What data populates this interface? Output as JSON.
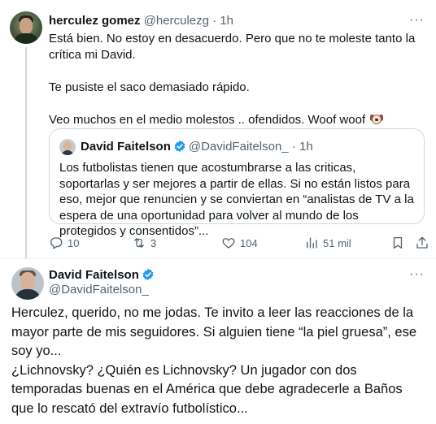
{
  "tweet1": {
    "author_name": "herculez gomez",
    "author_handle": "@herculezg",
    "separator": "·",
    "time": "1h",
    "more": "···",
    "lines": [
      "Está bien. No estoy en desacuerdo. Pero que no te moleste tanto la crítica mi David.",
      "Te pusiste el saco demasiado rápido.",
      "Veo muchos en el medio molestos .. ofendidos. Woof woof"
    ],
    "emoji_icon": "dog-face-icon",
    "quote": {
      "author_name": "David Faitelson",
      "author_handle": "@DavidFaitelson_",
      "separator": "·",
      "time": "1h",
      "text": "Los futbolistas tienen que acostumbrarse a las criticas, soportarlas y ser mejores a partir de ellas. Si no están listos para eso, mejor que renuncien y se conviertan en “analistas de TV a la espera de una oportunidad para volver al mundo de los protegidos y consentidos”..."
    },
    "actions": {
      "replies": "10",
      "reposts": "3",
      "likes": "104",
      "views": "51 mil"
    }
  },
  "tweet2": {
    "author_name": "David Faitelson",
    "author_handle": "@DavidFaitelson_",
    "more": "···",
    "paragraphs": [
      "Herculez, querido, no me jodas. Te invito a leer las reacciones de la mayor parte de mis seguidores. Si alguien tiene “la piel gruesa”, ese soy yo...",
      "¿Lichnovsky? ¿Quién es Lichnovsky? Un jugador con dos temporadas buenas en el América que debe agradecerle a Baños que lo rescató del extravío futbolístico..."
    ]
  },
  "colors": {
    "text": "#0f1419",
    "muted": "#536471",
    "border": "#cfd9de",
    "verified": "#1d9bf0"
  }
}
